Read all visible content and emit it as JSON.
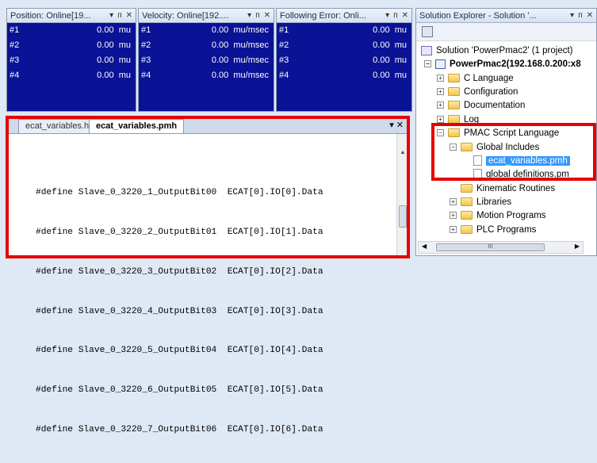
{
  "watch_panels": [
    {
      "title": "Position: Online[19...",
      "rows": [
        {
          "name": "#1",
          "value": "0.00",
          "unit": "mu"
        },
        {
          "name": "#2",
          "value": "0.00",
          "unit": "mu"
        },
        {
          "name": "#3",
          "value": "0.00",
          "unit": "mu"
        },
        {
          "name": "#4",
          "value": "0.00",
          "unit": "mu"
        }
      ]
    },
    {
      "title": "Velocity: Online[192....",
      "rows": [
        {
          "name": "#1",
          "value": "0.00",
          "unit": "mu/msec"
        },
        {
          "name": "#2",
          "value": "0.00",
          "unit": "mu/msec"
        },
        {
          "name": "#3",
          "value": "0.00",
          "unit": "mu/msec"
        },
        {
          "name": "#4",
          "value": "0.00",
          "unit": "mu/msec"
        }
      ]
    },
    {
      "title": "Following Error: Onli...",
      "rows": [
        {
          "name": "#1",
          "value": "0.00",
          "unit": "mu"
        },
        {
          "name": "#2",
          "value": "0.00",
          "unit": "mu"
        },
        {
          "name": "#3",
          "value": "0.00",
          "unit": "mu"
        },
        {
          "name": "#4",
          "value": "0.00",
          "unit": "mu"
        }
      ]
    }
  ],
  "panel_controls": {
    "dropdown": "▾",
    "pin": "ᴨ",
    "close": "✕"
  },
  "editor": {
    "tabs": [
      {
        "label": "ecat_variables.h"
      },
      {
        "label": "ecat_variables.pmh"
      }
    ],
    "tab_controls": "▾ ✕",
    "lines": [
      "#define Slave_0_3220_1_OutputBit00  ECAT[0].IO[0].Data",
      "#define Slave_0_3220_2_OutputBit01  ECAT[0].IO[1].Data",
      "#define Slave_0_3220_3_OutputBit02  ECAT[0].IO[2].Data",
      "#define Slave_0_3220_4_OutputBit03  ECAT[0].IO[3].Data",
      "#define Slave_0_3220_5_OutputBit04  ECAT[0].IO[4].Data",
      "#define Slave_0_3220_6_OutputBit05  ECAT[0].IO[5].Data",
      "#define Slave_0_3220_7_OutputBit06  ECAT[0].IO[6].Data"
    ]
  },
  "solution_explorer": {
    "title": "Solution Explorer - Solution '...",
    "tree": {
      "solution": "Solution 'PowerPmac2' (1 project)",
      "project": "PowerPmac2(192.168.0.200:x8",
      "c_language": "C Language",
      "configuration": "Configuration",
      "documentation": "Documentation",
      "log": "Log",
      "pmac_script": "PMAC Script Language",
      "global_includes": "Global Includes",
      "ecat_file": "ecat_variables.pmh",
      "global_defs": "global definitions.pm",
      "kinematic": "Kinematic Routines",
      "libraries": "Libraries",
      "motion": "Motion Programs",
      "plc": "PLC Programs"
    },
    "scroll_thumb": "III"
  },
  "highlight_color": "#e60000"
}
